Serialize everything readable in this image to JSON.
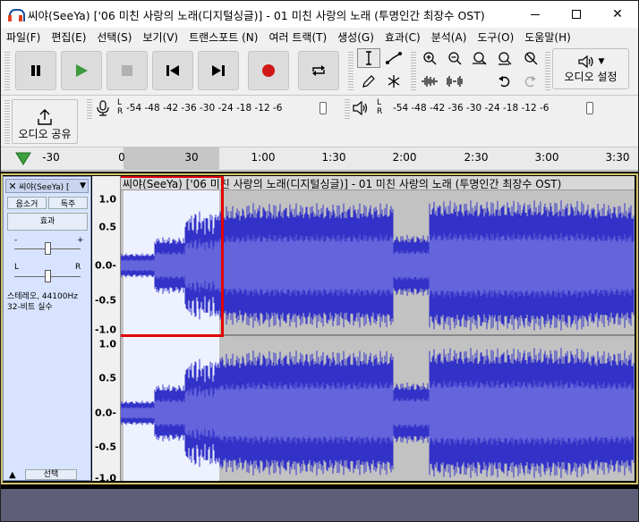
{
  "window": {
    "title": "씨야(SeeYa) ['06 미친 사랑의 노래(디지털싱글)] - 01 미친 사랑의 노래 (투명인간 최장수 OST)"
  },
  "menu": [
    "파일(F)",
    "편집(E)",
    "선택(S)",
    "보기(V)",
    "트랜스포트 (N)",
    "여러 트랙(T)",
    "생성(G)",
    "효과(C)",
    "분석(A)",
    "도구(O)",
    "도움말(H)"
  ],
  "toolbar": {
    "audio_setup_label": "오디오 설정",
    "share_label": "오디오 공유"
  },
  "meters": {
    "record_channels": [
      "L",
      "R"
    ],
    "play_channels": [
      "L",
      "R"
    ],
    "scale": [
      "-54",
      "-48",
      "-42",
      "-36",
      "-30",
      "-24",
      "-18",
      "-12",
      "-6"
    ]
  },
  "timeline": {
    "ticks": [
      "-30",
      "0",
      "30",
      "1:00",
      "1:30",
      "2:00",
      "2:30",
      "3:00",
      "3:30"
    ]
  },
  "track": {
    "name": "씨야(SeeYa) ['06 미친 사랑의 노래(디지털싱글)] - 01 미친 사랑의 노래 (투명인간 최장수 OST)",
    "short_name": "씨야(SeeYa) [",
    "mute": "음소거",
    "solo": "독주",
    "effects": "효과",
    "gain_minus": "-",
    "gain_plus": "+",
    "pan_left": "L",
    "pan_right": "R",
    "info_line1": "스테레오, 44100Hz",
    "info_line2": "32-비트 실수",
    "select": "선택"
  },
  "vruler": [
    "1.0",
    "0.5",
    "0.0-",
    "-0.5",
    "-1.0"
  ],
  "colors": {
    "wave": "#3232c8",
    "wave_rms": "#6464dc",
    "selection_bg": "#ffffff",
    "unselected_bg": "#c2c2c2",
    "annotation": "#e00000"
  }
}
